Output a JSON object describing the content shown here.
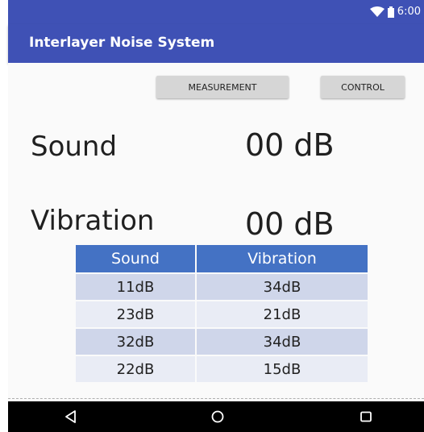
{
  "status_bar": {
    "time": "6:00",
    "icons": [
      "wifi-icon",
      "battery-icon"
    ]
  },
  "app_bar": {
    "title": "Interlayer Noise System"
  },
  "buttons": {
    "measurement": "MEASUREMENT",
    "control": "CONTROL"
  },
  "readings": {
    "sound_label": "Sound",
    "sound_value": "00 dB",
    "vibration_label": "Vibration",
    "vibration_value": "00 dB"
  },
  "table": {
    "headers": [
      "Sound",
      "Vibration"
    ],
    "rows": [
      [
        "11dB",
        "34dB"
      ],
      [
        "23dB",
        "21dB"
      ],
      [
        "32dB",
        "34dB"
      ],
      [
        "22dB",
        "15dB"
      ]
    ]
  },
  "nav_bar": {
    "icons": [
      "back-icon",
      "home-icon",
      "recents-icon"
    ]
  },
  "colors": {
    "primary": "#3f51b5",
    "table_header": "#4472c4",
    "row_odd": "#cfd6ea",
    "row_even": "#e9ecf5"
  }
}
